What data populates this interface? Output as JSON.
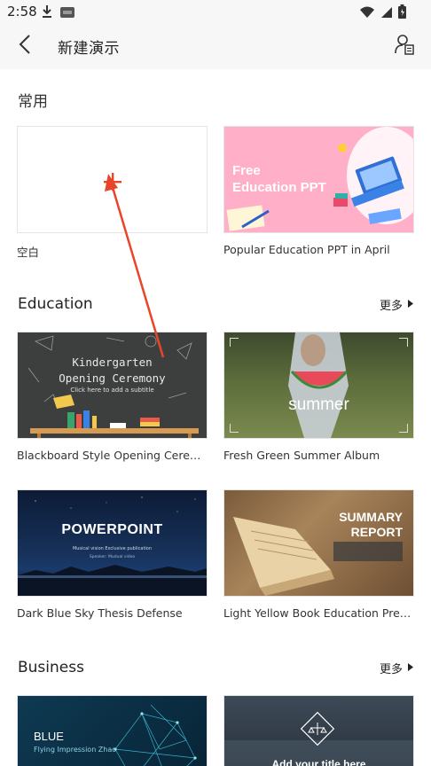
{
  "status_bar": {
    "time": "2:58",
    "left_icons": [
      "download-icon",
      "sim-badge-icon"
    ],
    "right_icons": [
      "wifi-icon",
      "signal-icon",
      "battery-icon"
    ]
  },
  "app_bar": {
    "title": "新建演示",
    "back_icon": "chevron-left-icon",
    "action_icon": "user-document-icon"
  },
  "sections": {
    "common": {
      "title": "常用",
      "cards": [
        {
          "label": "空白"
        },
        {
          "label": "Popular Education PPT in April",
          "thumb_text": "Free\nEducation PPT"
        }
      ]
    },
    "education": {
      "title": "Education",
      "more": "更多",
      "cards": [
        {
          "label": "Blackboard Style Opening Ceremony",
          "thumb_line1": "Kindergarten",
          "thumb_line2": "Opening Ceremony",
          "thumb_sub": "Click here to add a subtitle"
        },
        {
          "label": "Fresh Green Summer Album",
          "thumb_text": "summer"
        },
        {
          "label": "Dark Blue Sky Thesis Defense",
          "thumb_text": "POWERPOINT",
          "thumb_sub": "Musical vision Exclusive publication",
          "thumb_sub2": "Speaker: Mudual video"
        },
        {
          "label": "Light Yellow Book Education Presentation",
          "thumb_line1": "SUMMARY",
          "thumb_line2": "REPORT"
        }
      ]
    },
    "business": {
      "title": "Business",
      "more": "更多",
      "cards": [
        {
          "thumb_text": "BLUE",
          "thumb_sub": "Flying Impression Zhao"
        },
        {
          "thumb_text": "Add  your title here"
        }
      ]
    }
  },
  "colors": {
    "accent_annotation": "#e8452a",
    "edu_pink": "#ffb0c8"
  }
}
